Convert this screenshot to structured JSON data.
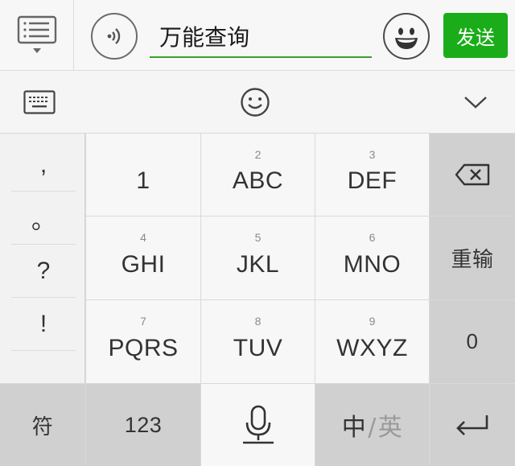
{
  "chat_input": {
    "text": "万能查询",
    "send_label": "发送"
  },
  "keyboard": {
    "punctuation": [
      ",",
      "。",
      "?",
      "!"
    ],
    "keys": [
      {
        "digit": "",
        "label": "1"
      },
      {
        "digit": "2",
        "label": "ABC"
      },
      {
        "digit": "3",
        "label": "DEF"
      },
      {
        "digit": "4",
        "label": "GHI"
      },
      {
        "digit": "5",
        "label": "JKL"
      },
      {
        "digit": "6",
        "label": "MNO"
      },
      {
        "digit": "7",
        "label": "PQRS"
      },
      {
        "digit": "8",
        "label": "TUV"
      },
      {
        "digit": "9",
        "label": "WXYZ"
      }
    ],
    "side": {
      "retype_label": "重输",
      "zero_label": "0"
    },
    "bottom": {
      "symbols_label": "符",
      "numbers_label": "123",
      "lang_cn": "中",
      "lang_sep": "/",
      "lang_en": "英"
    }
  },
  "colors": {
    "send_green": "#1aad19",
    "underline_green": "#3aa12a"
  },
  "icons": [
    "list-menu-icon",
    "voice-icon",
    "emoji-face-icon",
    "keyboard-icon",
    "smiley-icon",
    "chevron-down-icon",
    "backspace-icon",
    "microphone-icon",
    "enter-icon"
  ]
}
